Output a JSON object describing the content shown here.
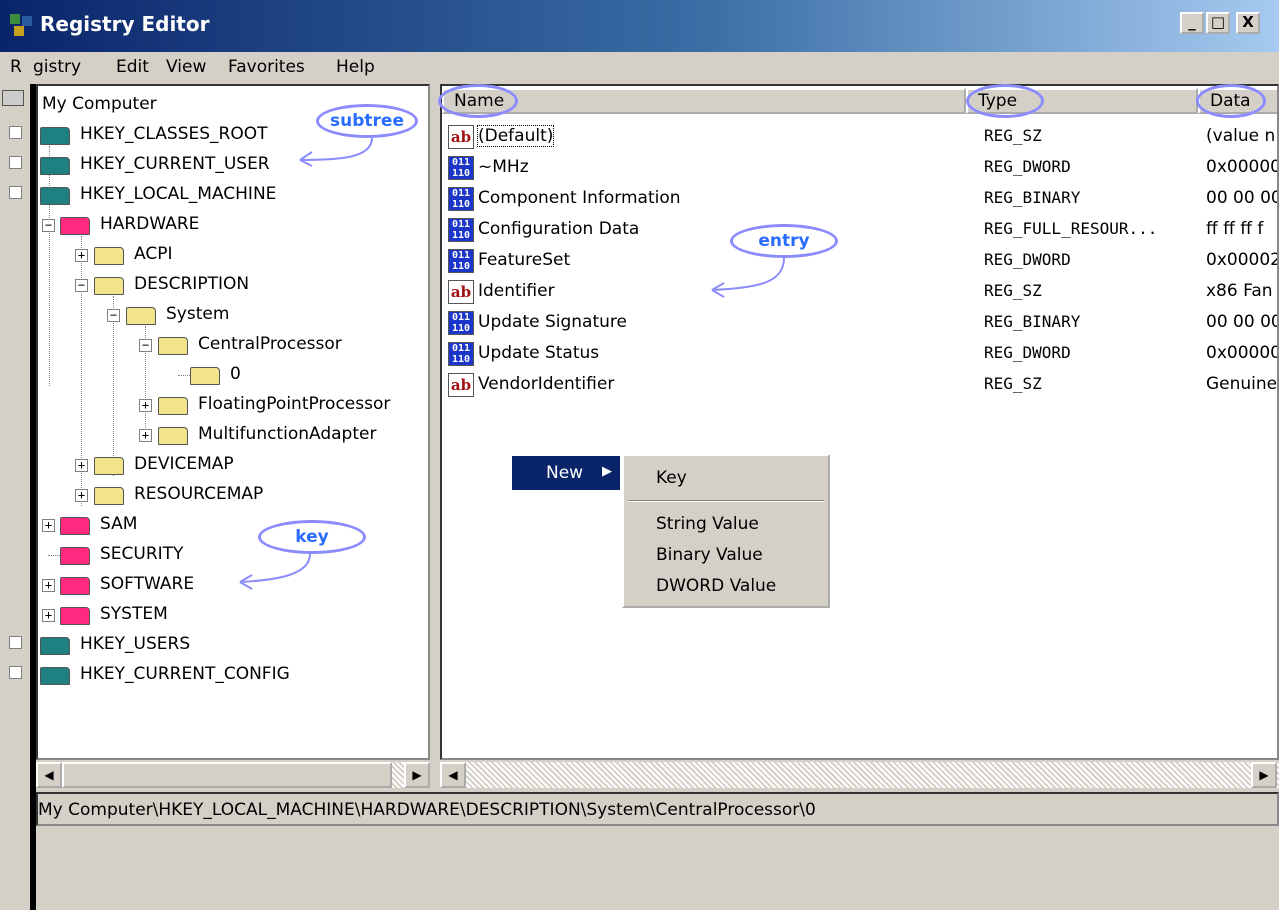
{
  "window": {
    "title": "Registry Editor"
  },
  "caption_buttons": {
    "minimize": "_",
    "maximize": "□",
    "close": "X"
  },
  "menu": [
    "Registry",
    "Edit",
    "View",
    "Favorites",
    "Help"
  ],
  "menu_visible": [
    "R",
    "gistry",
    "Edit",
    "View",
    "Favorites",
    "Help"
  ],
  "tree": {
    "root": "My Computer",
    "nodes": [
      {
        "label": "HKEY_CLASSES_ROOT"
      },
      {
        "label": "HKEY_CURRENT_USER"
      },
      {
        "label": "HKEY_LOCAL_MACHINE"
      },
      {
        "label": "HARDWARE"
      },
      {
        "label": "ACPI"
      },
      {
        "label": "DESCRIPTION"
      },
      {
        "label": "System"
      },
      {
        "label": "CentralProcessor"
      },
      {
        "label": "0"
      },
      {
        "label": "FloatingPointProcessor"
      },
      {
        "label": "MultifunctionAdapter"
      },
      {
        "label": "DEVICEMAP"
      },
      {
        "label": "RESOURCEMAP"
      },
      {
        "label": "SAM"
      },
      {
        "label": "SECURITY"
      },
      {
        "label": "SOFTWARE"
      },
      {
        "label": "SYSTEM"
      },
      {
        "label": "HKEY_USERS"
      },
      {
        "label": "HKEY_CURRENT_CONFIG"
      }
    ],
    "expanders": {
      "plus": "+",
      "minus": "−"
    }
  },
  "list": {
    "columns": [
      "Name",
      "Type",
      "Data"
    ],
    "rows": [
      {
        "icon": "string-value-icon",
        "name": "(Default)",
        "type": "REG_SZ",
        "data": "(value n"
      },
      {
        "icon": "binary-value-icon",
        "name": "~MHz",
        "type": "REG_DWORD",
        "data": "0x00000"
      },
      {
        "icon": "binary-value-icon",
        "name": "Component Information",
        "type": "REG_BINARY",
        "data": "00 00 00"
      },
      {
        "icon": "binary-value-icon",
        "name": "Configuration Data",
        "type": "REG_FULL_RESOUR...",
        "data": "ff ff ff f"
      },
      {
        "icon": "binary-value-icon",
        "name": "FeatureSet",
        "type": "REG_DWORD",
        "data": "0x00002"
      },
      {
        "icon": "string-value-icon",
        "name": "Identifier",
        "type": "REG_SZ",
        "data": "x86 Fan"
      },
      {
        "icon": "binary-value-icon",
        "name": "Update Signature",
        "type": "REG_BINARY",
        "data": "00 00 00"
      },
      {
        "icon": "binary-value-icon",
        "name": "Update Status",
        "type": "REG_DWORD",
        "data": "0x00000"
      },
      {
        "icon": "string-value-icon",
        "name": "VendorIdentifier",
        "type": "REG_SZ",
        "data": "Genuine"
      }
    ],
    "icon_glyphs": {
      "string": "ab",
      "binary": "011\n110"
    }
  },
  "context_menu": {
    "new_label": "New",
    "arrow": "▶",
    "submenu": [
      "Key",
      "String Value",
      "Binary Value",
      "DWORD Value"
    ]
  },
  "annotations": {
    "subtree": "subtree",
    "entry": "entry",
    "key": "key"
  },
  "scroll_arrows": {
    "left": "◀",
    "right": "▶"
  },
  "status": "My Computer\\HKEY_LOCAL_MACHINE\\HARDWARE\\DESCRIPTION\\System\\CentralProcessor\\0",
  "colors": {
    "title_start": "#0a246a",
    "title_end": "#a6caf0",
    "annotation": "#2a6cff",
    "key_pink": "#ff2a80",
    "hive_teal": "#1e8080",
    "folder_yellow": "#f1e48a"
  }
}
